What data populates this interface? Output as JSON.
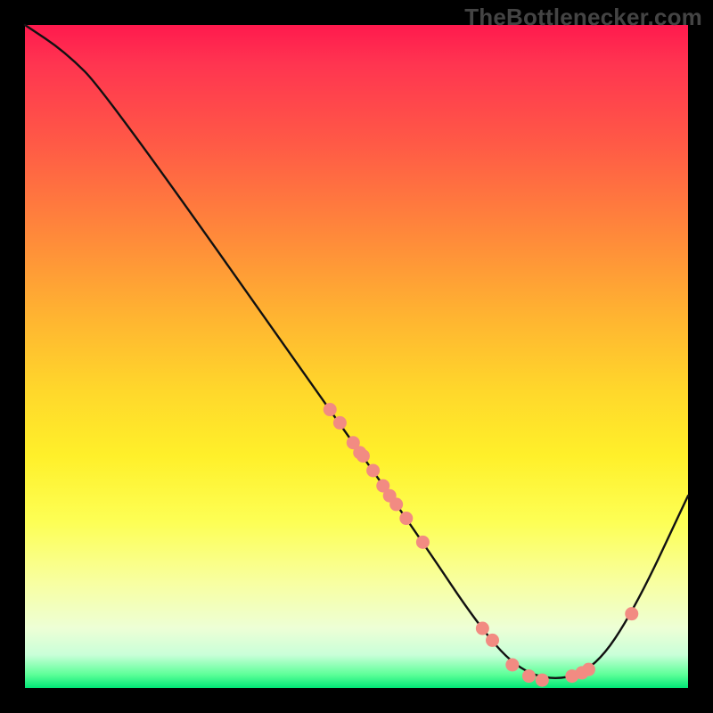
{
  "watermark": "TheBottlenecker.com",
  "chart_data": {
    "type": "line",
    "title": "",
    "xlabel": "",
    "ylabel": "",
    "xlim": [
      0,
      100
    ],
    "ylim": [
      0,
      100
    ],
    "curve": [
      {
        "x": 0,
        "y": 100
      },
      {
        "x": 6,
        "y": 96
      },
      {
        "x": 12,
        "y": 90
      },
      {
        "x": 46,
        "y": 42
      },
      {
        "x": 60,
        "y": 22
      },
      {
        "x": 68,
        "y": 10
      },
      {
        "x": 74,
        "y": 3
      },
      {
        "x": 80,
        "y": 1
      },
      {
        "x": 86,
        "y": 3
      },
      {
        "x": 92,
        "y": 12
      },
      {
        "x": 100,
        "y": 29
      }
    ],
    "markers": [
      {
        "x": 46.0,
        "y": 42.0
      },
      {
        "x": 47.5,
        "y": 40.0
      },
      {
        "x": 49.5,
        "y": 37.0
      },
      {
        "x": 50.5,
        "y": 35.5
      },
      {
        "x": 51.0,
        "y": 35.0
      },
      {
        "x": 52.5,
        "y": 32.8
      },
      {
        "x": 54.0,
        "y": 30.5
      },
      {
        "x": 55.0,
        "y": 29.0
      },
      {
        "x": 56.0,
        "y": 27.7
      },
      {
        "x": 57.5,
        "y": 25.6
      },
      {
        "x": 60.0,
        "y": 22.0
      },
      {
        "x": 69.0,
        "y": 9.0
      },
      {
        "x": 70.5,
        "y": 7.2
      },
      {
        "x": 73.5,
        "y": 3.5
      },
      {
        "x": 76.0,
        "y": 1.8
      },
      {
        "x": 78.0,
        "y": 1.2
      },
      {
        "x": 82.5,
        "y": 1.8
      },
      {
        "x": 84.0,
        "y": 2.3
      },
      {
        "x": 85.0,
        "y": 2.8
      },
      {
        "x": 91.5,
        "y": 11.2
      }
    ],
    "marker_color": "#f28b82",
    "line_color": "#111"
  }
}
